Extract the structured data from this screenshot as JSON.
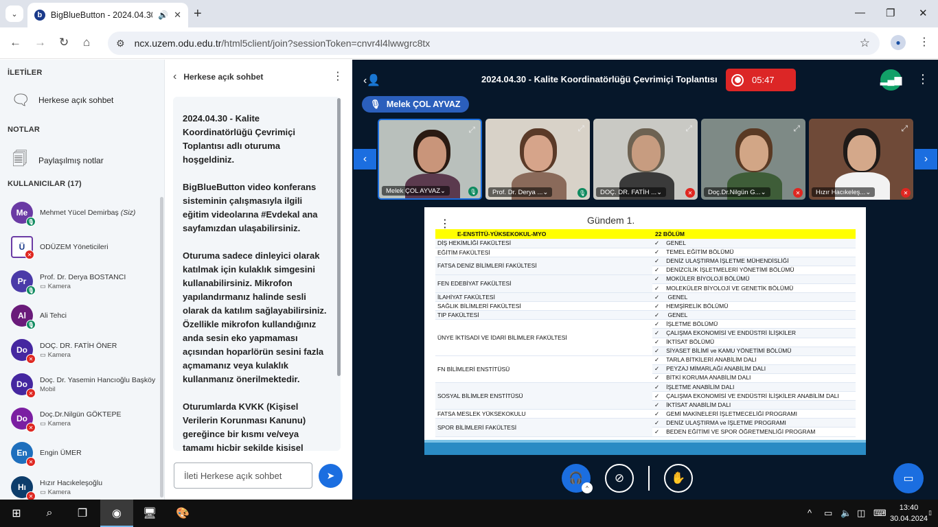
{
  "browser": {
    "tab_title": "BigBlueButton - 2024.04.30",
    "url_host": "ncx.uzem.odu.edu.tr",
    "url_path": "/html5client/join?sessionToken=cnvr4l4lwwgrc8tx"
  },
  "sidebar": {
    "messages_title": "İLETİLER",
    "public_chat": "Herkese açık sohbet",
    "notes_title": "NOTLAR",
    "shared_notes": "Paylaşılmış notlar",
    "users_title": "KULLANICILAR (17)",
    "users": [
      {
        "initials": "Me",
        "name": "Mehmet Yücel Demirbaş",
        "you": "(Siz)",
        "sub": "",
        "color": "#6a3aa4",
        "mic": "on"
      },
      {
        "initials": "Ü",
        "name": "ODÜZEM Yöneticileri",
        "sub": "",
        "color": "#ffffff",
        "mic": "off"
      },
      {
        "initials": "Pr",
        "name": "Prof. Dr. Derya BOSTANCI",
        "sub": "Kamera",
        "color": "#4a3aa8",
        "mic": "on"
      },
      {
        "initials": "Al",
        "name": "Ali Tehci",
        "sub": "",
        "color": "#6a1b7a",
        "mic": "on"
      },
      {
        "initials": "Do",
        "name": "DOÇ. DR. FATİH ÖNER",
        "sub": "Kamera",
        "color": "#4527a0",
        "mic": "off"
      },
      {
        "initials": "Do",
        "name": "Doç. Dr. Yasemin Hancıoğlu Başköy",
        "sub": "Mobil",
        "color": "#4527a0",
        "mic": "off"
      },
      {
        "initials": "Do",
        "name": "Doç.Dr.Nilgün GÖKTEPE",
        "sub": "Kamera",
        "color": "#7b1fa2",
        "mic": "off"
      },
      {
        "initials": "En",
        "name": "Engin ÜMER",
        "sub": "",
        "color": "#1e6fbd",
        "mic": "off"
      },
      {
        "initials": "Hı",
        "name": "Hızır Hacıkeleşoğlu",
        "sub": "Kamera",
        "color": "#0d3d6b",
        "mic": "off"
      }
    ]
  },
  "chat": {
    "header": "Herkese açık sohbet",
    "messages": [
      "2024.04.30 - Kalite Koordinatörlüğü Çevrimiçi Toplantısı adlı oturuma hoşgeldiniz.",
      "BigBlueButton video konferans sisteminin çalışmasıyla ilgili eğitim videolarına #Evdekal ana sayfamızdan ulaşabilirsiniz.",
      "Oturuma sadece dinleyici olarak katılmak için kulaklık simgesini kullanabilirsiniz. Mikrofon yapılandırmanız halinde sesli olarak da katılım sağlayabilirsiniz. Özellikle mikrofon kullandığınız anda sesin eko yapmaması açısından hoparlörün sesini fazla açmamanız veya kulaklık kullanmanız önerilmektedir.",
      "Oturumlarda KVKK (Kişisel Verilerin Korunması Kanunu) gereğince bir kısmı ve/veya tamamı hiçbir şekilde kişisel"
    ],
    "input_placeholder": "İleti Herkese açık sohbet"
  },
  "meeting": {
    "title": "2024.04.30 - Kalite Koordinatörlüğü Çevrimiçi Toplantısı",
    "rec_time": "05:47",
    "talker": "Melek ÇOL AYVAZ",
    "cameras": [
      {
        "name": "Melek ÇOL AYVAZ",
        "mic": "on",
        "bg": "#b9c0bc",
        "skin": "#c9957a",
        "hair": "#2a1a12",
        "shirt": "#5b3a4e"
      },
      {
        "name": "Prof. Dr. Derya ...",
        "mic": "on",
        "bg": "#d8d2c8",
        "skin": "#d6a48a",
        "hair": "#5a3a28",
        "shirt": "#8a6a5a"
      },
      {
        "name": "DOÇ. DR. FATİH ...",
        "mic": "off",
        "bg": "#c9c9c4",
        "skin": "#c79c80",
        "hair": "#6d6252",
        "shirt": "#3a3a3a"
      },
      {
        "name": "Doç.Dr.Nilgün G...",
        "mic": "off",
        "bg": "#7e8a86",
        "skin": "#d2a686",
        "hair": "#5a3a24",
        "shirt": "#3e5d38"
      },
      {
        "name": "Hızır Hacıkeleş...",
        "mic": "off",
        "bg": "#6f4a38",
        "skin": "#d4a88a",
        "hair": "#1e1a18",
        "shirt": "#f2f2f2"
      }
    ],
    "slide": {
      "title": "Gündem 1.",
      "header_left": "E-ENSTİTÜ-YÜKSEKOKUL-MYO",
      "header_right": "22 BÖLÜM",
      "rows": [
        {
          "unit": "DİŞ HEKİMLİĞİ FAKÜLTESİ",
          "items": [
            "GENEL"
          ]
        },
        {
          "unit": "EĞİTİM FAKÜLTESİ",
          "items": [
            "TEMEL EĞİTİM BÖLÜMÜ"
          ]
        },
        {
          "unit": "FATSA DENİZ BİLİMLERİ FAKÜLTESİ",
          "items": [
            "DENİZ ULAŞTIRMA İŞLETME MÜHENDİSLİĞİ",
            "DENİZCİLİK İŞLETMELERİ YÖNETİMİ BÖLÜMÜ"
          ]
        },
        {
          "unit": "FEN EDEBİYAT FAKÜLTESİ",
          "items": [
            "MOKÜLER BİYOLOJİ BÖLÜMÜ",
            "MOLEKÜLER BİYOLOJİ VE GENETİK BÖLÜMÜ"
          ]
        },
        {
          "unit": "İLAHİYAT FAKÜLTESİ",
          "items": [
            " GENEL"
          ]
        },
        {
          "unit": "SAĞLIK BİLİMLERİ FAKÜLTESİ",
          "items": [
            "HEMŞİRELİK BÖLÜMÜ"
          ]
        },
        {
          "unit": "TIP FAKÜLTESİ",
          "items": [
            " GENEL"
          ]
        },
        {
          "unit": "ÜNYE İKTİSADİ VE İDARİ BİLİMLER FAKÜLTESİ",
          "items": [
            "İŞLETME BÖLÜMÜ",
            "ÇALIŞMA EKONOMİSİ VE ENDÜSTRİ İLİŞKİLER",
            "İKTİSAT BÖLÜMÜ",
            "SİYASET BİLİMİ ve KAMU YÖNETİMİ BÖLÜMÜ"
          ]
        },
        {
          "unit": "FN BİLİMLERİ ENSTİTÜSÜ",
          "items": [
            "TARLA BİTKİLERİ ANABİLİM DALI",
            "PEYZAJ MİMARLAĞI ANABİLİM DALI",
            "BİTKİ KORUMA ANABİLİM DALI"
          ]
        },
        {
          "unit": "SOSYAL BİLİMLER ENSTİTÜSÜ",
          "items": [
            "İŞLETME ANABİLİM DALI",
            "ÇALIŞMA EKONOMİSİ VE ENDÜSTRİ İLİŞKİLER ANABİLİM DALI",
            "İKTİSAT ANABİLİM DALI"
          ]
        },
        {
          "unit": "FATSA MESLEK YÜKSEKOKULU",
          "items": [
            "GEMİ MAKİNELERİ İŞLETMECELİĞİ PROGRAMI"
          ]
        },
        {
          "unit": "SPOR BİLİMLERİ FAKÜLTESİ",
          "items": [
            "DENİZ ULAŞTIRMA ve İŞLETME PROGRAMI",
            "BEDEN EĞİTİMİ VE SPOR ÖĞRETMENLİĞİ PROGRAM"
          ]
        }
      ]
    }
  },
  "taskbar": {
    "time": "13:40",
    "date": "30.04.2024"
  }
}
